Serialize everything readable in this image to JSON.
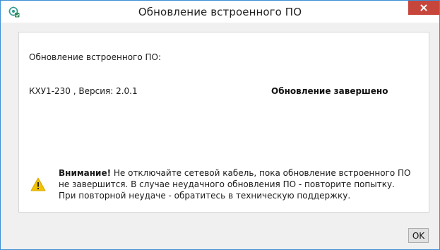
{
  "window": {
    "title": "Обновление встроенного ПО",
    "app_icon": "firmware-app-icon",
    "close_icon": "close-icon",
    "colors": {
      "border": "#3c8fd6",
      "close_bg": "#c7463c",
      "warning": "#f2c200"
    }
  },
  "main": {
    "heading": "Обновление встроенного ПО:",
    "device": {
      "name_version": "КХУ1-230 , Версия: 2.0.1",
      "status": "Обновление завершено"
    },
    "warning": {
      "icon": "warning-icon",
      "label": "Внимание!",
      "text": " Не отключайте сетевой кабель, пока обновление встроенного ПО не завершится. В случае неудачного обновления ПО - повторите попытку. При повторной неудаче - обратитесь в техническую поддержку."
    }
  },
  "footer": {
    "ok_label": "OK"
  }
}
